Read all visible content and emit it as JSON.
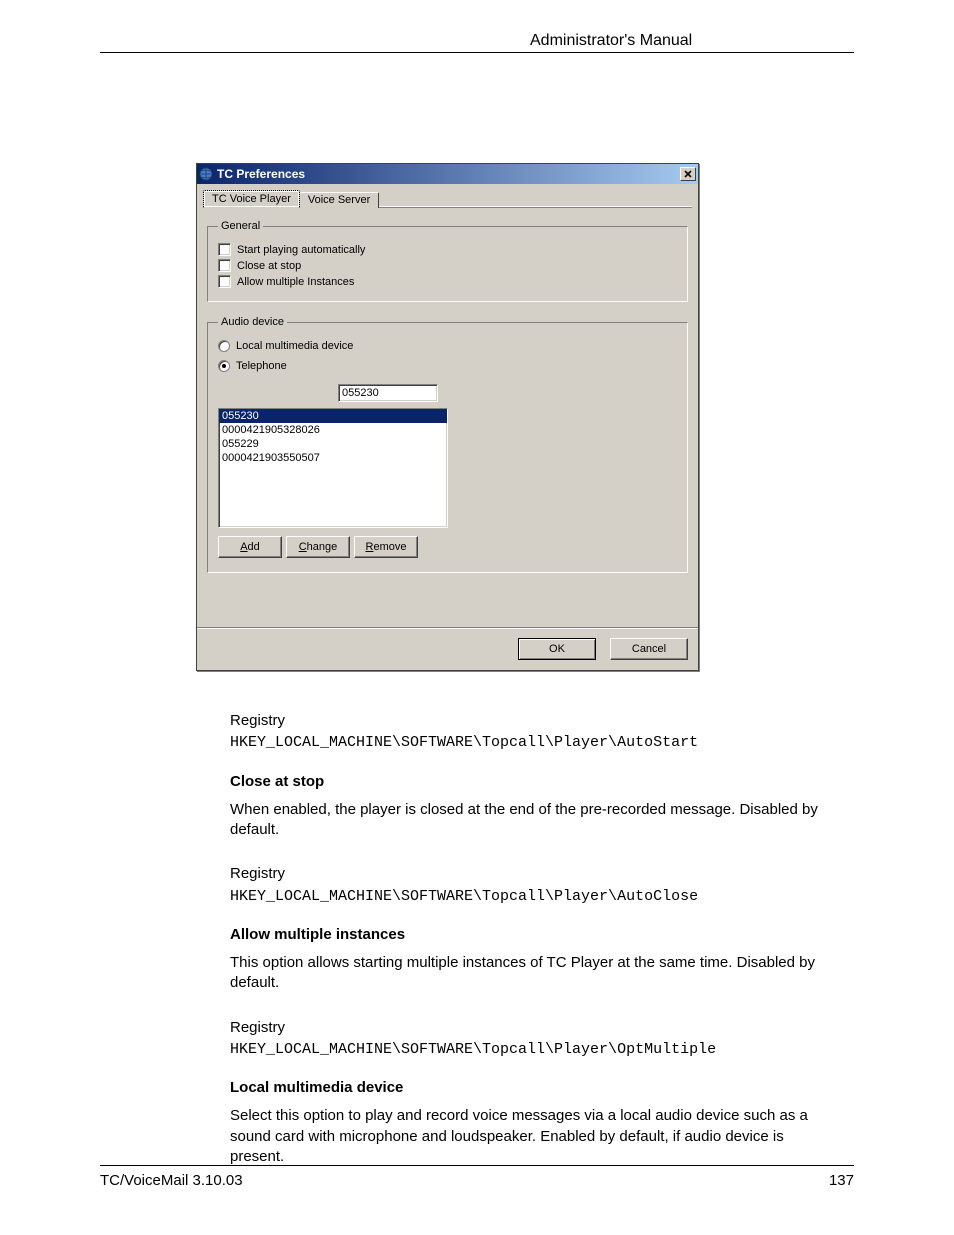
{
  "header": {
    "title": "Administrator's Manual"
  },
  "dialog": {
    "title": "TC Preferences",
    "tabs": {
      "active": "TC Voice Player",
      "inactive": "Voice Server"
    },
    "general": {
      "legend": "General",
      "opt1": "Start playing automatically",
      "opt2": "Close at stop",
      "opt3": "Allow multiple Instances"
    },
    "audio": {
      "legend": "Audio device",
      "radio1": "Local multimedia device",
      "radio2": "Telephone",
      "input_value": "055230",
      "list": [
        "055230",
        "0000421905328026",
        "055229",
        "0000421903550507"
      ],
      "btn_add": "Add",
      "btn_change": "Change",
      "btn_remove": "Remove"
    },
    "footer": {
      "ok": "OK",
      "cancel": "Cancel"
    }
  },
  "sections": [
    {
      "label": "Registry",
      "path": "HKEY_LOCAL_MACHINE\\SOFTWARE\\Topcall\\Player\\AutoStart",
      "heading": "Close at stop",
      "body": "When enabled, the player is closed at the end of the pre-recorded message. Disabled by default."
    },
    {
      "label": "Registry",
      "path": "HKEY_LOCAL_MACHINE\\SOFTWARE\\Topcall\\Player\\AutoClose",
      "heading": "Allow multiple instances",
      "body": "This option allows starting multiple instances of TC Player at the same time. Disabled by default."
    },
    {
      "label": "Registry",
      "path": "HKEY_LOCAL_MACHINE\\SOFTWARE\\Topcall\\Player\\OptMultiple",
      "heading": "Local multimedia device",
      "body": "Select this option to play and record voice messages via a local audio device such as a sound card with microphone and loudspeaker. Enabled by default, if audio device is present."
    }
  ],
  "footer": {
    "left": "TC/VoiceMail 3.10.03",
    "right": "137"
  }
}
